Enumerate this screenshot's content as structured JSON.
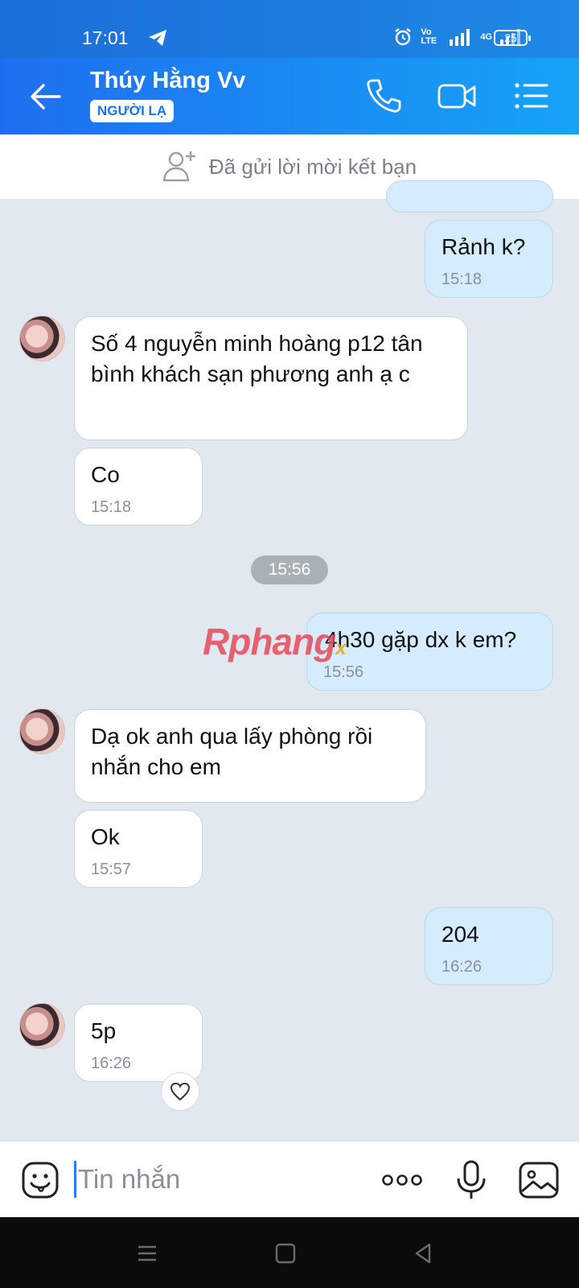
{
  "status_bar": {
    "time": "17:01",
    "network_labels": "Vo LTE",
    "net_type": "4G",
    "battery": "25"
  },
  "header": {
    "contact_name": "Thúy Hằng Vv",
    "badge": "NGƯỜI LẠ",
    "icons": [
      "back-arrow-icon",
      "phone-icon",
      "video-call-icon",
      "menu-list-icon"
    ]
  },
  "friend_request": {
    "text": "Đã gửi lời mời kết bạn",
    "icon": "add-friend-icon"
  },
  "messages": [
    {
      "side": "out",
      "text": "Rảnh k?",
      "time": "15:18"
    },
    {
      "side": "in",
      "text": "Số 4 nguyễn minh hoàng p12 tân bình khách sạn phương anh ạ c",
      "time": ""
    },
    {
      "side": "in",
      "text": "Co",
      "time": "15:18"
    },
    {
      "side": "out",
      "text": "4h30 gặp dx k em?",
      "time": "15:56"
    },
    {
      "side": "in",
      "text": "Dạ ok anh qua lấy phòng rồi nhắn cho em",
      "time": ""
    },
    {
      "side": "in",
      "text": "Ok",
      "time": "15:57"
    },
    {
      "side": "out",
      "text": "204",
      "time": "16:26"
    },
    {
      "side": "in",
      "text": "5p",
      "time": "16:26"
    }
  ],
  "time_divider": "15:56",
  "watermark": {
    "part1": "Rphang",
    "part2": "",
    "part3": "x"
  },
  "input_bar": {
    "placeholder": "Tin nhắn",
    "icons": [
      "emoji-icon",
      "more-dots-icon",
      "microphone-icon",
      "image-icon"
    ]
  },
  "colors": {
    "header_start": "#1e6ff0",
    "header_end": "#16a3f7",
    "outgoing_bubble": "#d4ecfd",
    "chat_background": "#e2e8f0"
  }
}
